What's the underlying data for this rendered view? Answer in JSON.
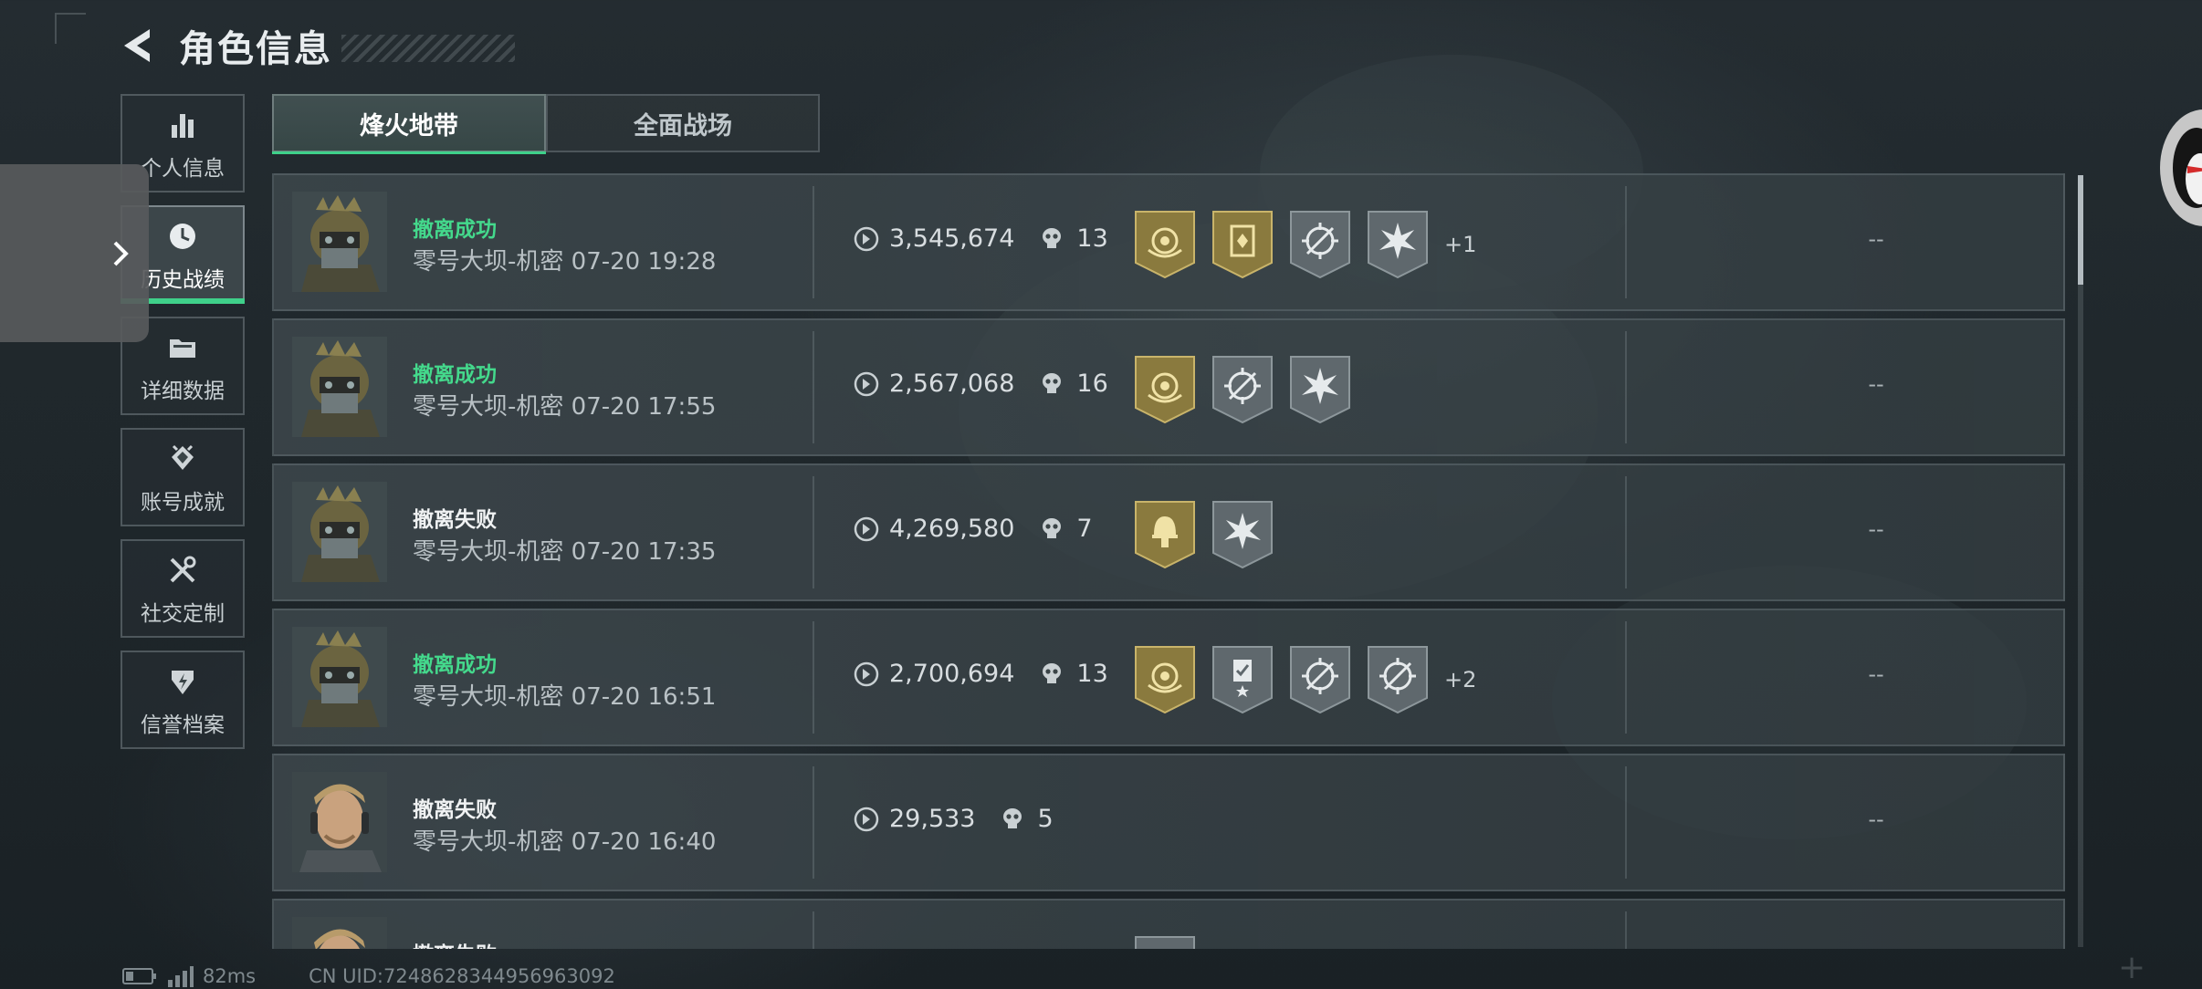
{
  "header": {
    "title": "角色信息"
  },
  "sidebar": {
    "items": [
      {
        "label": "个人信息",
        "icon": "bar-chart-icon",
        "active": false
      },
      {
        "label": "历史战绩",
        "icon": "clock-icon",
        "active": true
      },
      {
        "label": "详细数据",
        "icon": "folder-icon",
        "active": false
      },
      {
        "label": "账号成就",
        "icon": "achievement-icon",
        "active": false
      },
      {
        "label": "社交定制",
        "icon": "tools-icon",
        "active": false
      },
      {
        "label": "信誉档案",
        "icon": "shield-icon",
        "active": false
      }
    ]
  },
  "tabs": [
    {
      "label": "烽火地带",
      "active": true
    },
    {
      "label": "全面战场",
      "active": false
    }
  ],
  "colors": {
    "success": "#44d98c",
    "accent": "#3fd08a",
    "badge_gold": "#8a7a3e",
    "badge_gray": "#5f686d"
  },
  "matches": [
    {
      "result": "撤离成功",
      "status": "success",
      "map": "零号大坝-机密",
      "time": "07-20 19:28",
      "value": "3,545,674",
      "kills": "13",
      "avatar": "armored-soldier",
      "badges": [
        "gold-laurel-badge",
        "gold-card-badge",
        "gray-crosshair-badge",
        "gray-burst-badge"
      ],
      "extra": "+1",
      "note": "--"
    },
    {
      "result": "撤离成功",
      "status": "success",
      "map": "零号大坝-机密",
      "time": "07-20 17:55",
      "value": "2,567,068",
      "kills": "16",
      "avatar": "armored-soldier",
      "badges": [
        "gold-laurel-badge",
        "gray-crosshair-badge",
        "gray-burst-badge"
      ],
      "extra": "",
      "note": "--"
    },
    {
      "result": "撤离失败",
      "status": "fail",
      "map": "零号大坝-机密",
      "time": "07-20 17:35",
      "value": "4,269,580",
      "kills": "7",
      "avatar": "armored-soldier",
      "badges": [
        "gold-helmet-badge",
        "gray-burst-badge"
      ],
      "extra": "",
      "note": "--"
    },
    {
      "result": "撤离成功",
      "status": "success",
      "map": "零号大坝-机密",
      "time": "07-20 16:51",
      "value": "2,700,694",
      "kills": "13",
      "avatar": "armored-soldier",
      "badges": [
        "gold-laurel-badge",
        "gray-medal-badge",
        "gray-crosshair-badge",
        "gray-crosshair-badge"
      ],
      "extra": "+2",
      "note": "--"
    },
    {
      "result": "撤离失败",
      "status": "fail",
      "map": "零号大坝-机密",
      "time": "07-20 16:40",
      "value": "29,533",
      "kills": "5",
      "avatar": "headset-operator",
      "badges": [],
      "extra": "",
      "note": "--"
    },
    {
      "result": "撤离失败",
      "status": "fail",
      "map": "",
      "time": "",
      "value": "",
      "kills": "",
      "avatar": "headset-operator",
      "badges": [
        "gray-medal-badge"
      ],
      "extra": "",
      "note": ""
    }
  ],
  "footer": {
    "ping": "82ms",
    "uid": "CN UID:7248628344956963092"
  }
}
